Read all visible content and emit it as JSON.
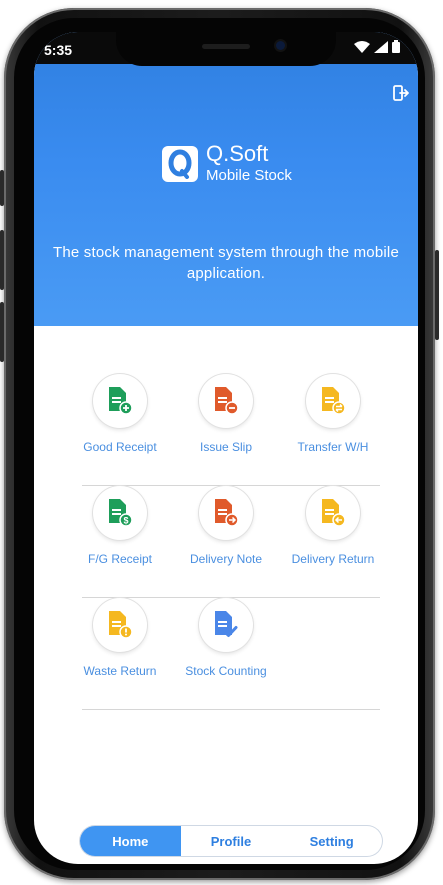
{
  "status": {
    "time": "5:35",
    "icons": [
      "wifi-icon",
      "signal-icon",
      "battery-icon"
    ]
  },
  "app": {
    "logo_letter": "Q",
    "name": "Q.Soft",
    "subtitle": "Mobile Stock",
    "tagline": "The stock management system through the mobile application.",
    "logout_icon": "logout-icon"
  },
  "colors": {
    "brand_blue": "#3a8cf0",
    "label_blue": "#4a8fe0",
    "green": "#1e9e5a",
    "red": "#e05a2b",
    "yellow": "#f5b820",
    "blue": "#4a86e8"
  },
  "menu": {
    "items": [
      {
        "label": "Good Receipt",
        "icon": "document-plus-icon"
      },
      {
        "label": "Issue Slip",
        "icon": "document-minus-icon"
      },
      {
        "label": "Transfer W/H",
        "icon": "document-transfer-icon"
      },
      {
        "label": "F/G Receipt",
        "icon": "document-money-icon"
      },
      {
        "label": "Delivery Note",
        "icon": "document-arrow-icon"
      },
      {
        "label": "Delivery Return",
        "icon": "document-return-icon"
      },
      {
        "label": "Waste Return",
        "icon": "document-alert-icon"
      },
      {
        "label": "Stock Counting",
        "icon": "document-check-icon"
      }
    ]
  },
  "tabs": [
    {
      "label": "Home",
      "active": true
    },
    {
      "label": "Profile",
      "active": false
    },
    {
      "label": "Setting",
      "active": false
    }
  ]
}
